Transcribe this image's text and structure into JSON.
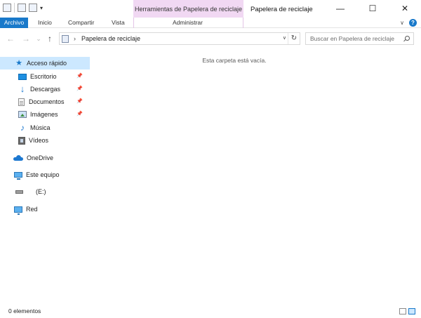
{
  "titlebar": {
    "contextual_tab": "Herramientas de Papelera de reciclaje",
    "window_title": "Papelera de reciclaje",
    "minimize_glyph": "—",
    "maximize_glyph": "☐",
    "close_glyph": "✕",
    "qat_drop_glyph": "▾"
  },
  "ribbon": {
    "tabs": [
      "Archivo",
      "Inicio",
      "Compartir",
      "Vista"
    ],
    "contextual_sub_tab": "Administrar",
    "expand_glyph": "∨",
    "help_glyph": "?",
    "accent_color": "#1979ca"
  },
  "navigation": {
    "back_glyph": "←",
    "forward_glyph": "→",
    "history_glyph": "⌄",
    "up_glyph": "↑",
    "address_separator": "›",
    "address_path": "Papelera de reciclaje",
    "address_drop_glyph": "∨",
    "refresh_glyph": "↻",
    "search_placeholder": "Buscar en Papelera de reciclaje"
  },
  "sidebar": {
    "items": [
      {
        "label": "Acceso rápido",
        "icon": "star-icon"
      },
      {
        "label": "Escritorio",
        "icon": "desktop-icon",
        "pinned": true
      },
      {
        "label": "Descargas",
        "icon": "download-icon",
        "pinned": true
      },
      {
        "label": "Documentos",
        "icon": "document-icon",
        "pinned": true
      },
      {
        "label": "Imágenes",
        "icon": "images-icon",
        "pinned": true
      },
      {
        "label": "Música",
        "icon": "music-icon"
      },
      {
        "label": "Vídeos",
        "icon": "video-icon"
      },
      {
        "label": "OneDrive",
        "icon": "cloud-icon"
      },
      {
        "label": "Este equipo",
        "icon": "pc-icon"
      },
      {
        "label": "(E:)",
        "icon": "drive-icon"
      },
      {
        "label": "Red",
        "icon": "network-icon"
      }
    ],
    "pin_glyph": "📌",
    "star_glyph": "★",
    "download_glyph": "↓",
    "music_glyph": "♪",
    "selected_color": "#cce8ff"
  },
  "content": {
    "empty_message": "Esta carpeta está vacía."
  },
  "status": {
    "item_count": "0 elementos"
  }
}
